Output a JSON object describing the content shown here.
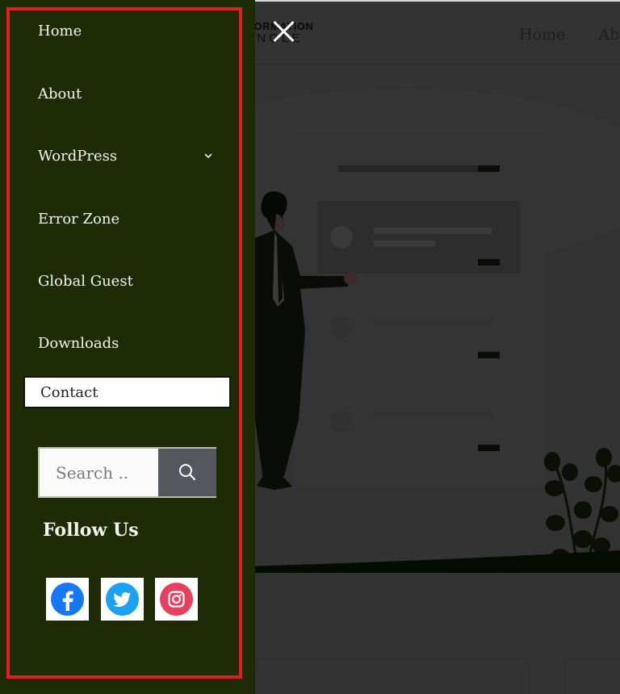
{
  "site": {
    "logo_top": "INFORMATION",
    "logo_bottom": "JUNGLE",
    "header_nav": [
      "Home",
      "About"
    ]
  },
  "drawer": {
    "close_label": "Close menu",
    "menu": [
      {
        "label": "Home"
      },
      {
        "label": "About"
      },
      {
        "label": "WordPress",
        "has_submenu": true
      },
      {
        "label": "Error Zone"
      },
      {
        "label": "Global Guest"
      },
      {
        "label": "Downloads"
      },
      {
        "label": "Contact",
        "focused": true
      }
    ],
    "search": {
      "placeholder": "Search ..",
      "value": "",
      "button_label": "Search"
    },
    "follow": {
      "title": "Follow Us",
      "links": [
        {
          "network": "Facebook",
          "icon": "facebook-icon",
          "color": "#1877f2"
        },
        {
          "network": "Twitter",
          "icon": "twitter-icon",
          "color": "#1da1f2"
        },
        {
          "network": "Instagram",
          "icon": "instagram-icon",
          "color": "#e4405f"
        }
      ]
    }
  },
  "colors": {
    "drawer_bg": "#1f2b07",
    "outline": "#e21d24",
    "overlay_bg": "#333333",
    "search_button": "#56565e"
  }
}
